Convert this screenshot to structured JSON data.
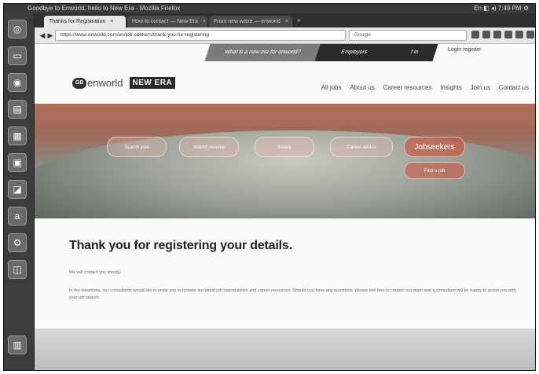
{
  "os": {
    "window_title": "Goodbye to Enworld, hello to New Era - Mozilla Firefox",
    "tray": "En  ◧  ◂)  7:49 PM  ⚙"
  },
  "launcher": {
    "items": [
      "dash",
      "files",
      "browser",
      "writer",
      "calc",
      "impress",
      "software",
      "amazon",
      "settings",
      "workspaces",
      "trash"
    ]
  },
  "browser": {
    "tabs": [
      {
        "label": "Thanks for Registration"
      },
      {
        "label": "How to contact — New Era"
      },
      {
        "label": "From new wave — enworld"
      }
    ],
    "new_tab": "+",
    "url": "https://www.enworld.com/en/job-seekers/thank-you-for-registering",
    "search_placeholder": "Google"
  },
  "page": {
    "utility": {
      "left_text": "What is a new era for enworld?",
      "employers": "Employers",
      "social": "f  in",
      "login": "Login   register"
    },
    "logo": {
      "short": "GB",
      "name": "enworld",
      "new_era": "NEW ERA"
    },
    "nav": [
      "All jobs",
      "About us",
      "Career resources",
      "Insights",
      "Join us",
      "Contact us"
    ],
    "hero_buttons": [
      "Search jobs",
      "Submit resume",
      "Salary",
      "Career advice",
      "Jobseekers",
      "Find a job"
    ],
    "title": "Thank you for registering your details.",
    "para1": "We will contact you shortly.",
    "para2": "In the meantime, our consultants would like to invite you to browse our latest job opportunities and career resources. Should you have any questions, please feel free to contact our team and a consultant will be happy to assist you with your job search."
  }
}
